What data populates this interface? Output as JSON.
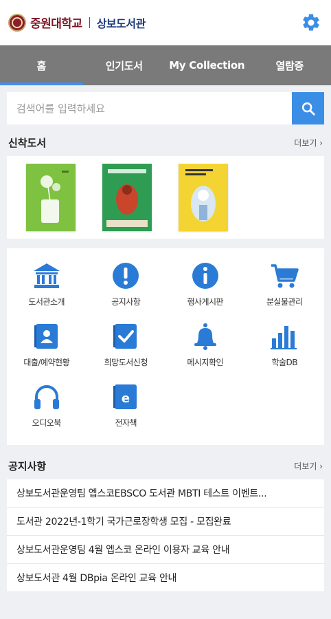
{
  "header": {
    "univ_name": "중원대학교",
    "lib_name": "상보도서관",
    "settings_icon": "gear-icon"
  },
  "tabs": [
    {
      "label": "홈",
      "active": true
    },
    {
      "label": "인기도서",
      "active": false
    },
    {
      "label": "My Collection",
      "active": false
    },
    {
      "label": "열람증",
      "active": false
    }
  ],
  "search": {
    "placeholder": "검색어를 입력하세요",
    "value": ""
  },
  "new_books": {
    "title": "신착도서",
    "more_label": "더보기 ›"
  },
  "menu": [
    {
      "label": "도서관소개",
      "icon": "library-icon"
    },
    {
      "label": "공지사항",
      "icon": "exclamation-icon"
    },
    {
      "label": "행사게시판",
      "icon": "info-icon"
    },
    {
      "label": "분실물관리",
      "icon": "cart-icon"
    },
    {
      "label": "대출/예약현황",
      "icon": "person-book-icon"
    },
    {
      "label": "희망도서신청",
      "icon": "check-book-icon"
    },
    {
      "label": "메시지확인",
      "icon": "bell-icon"
    },
    {
      "label": "학술DB",
      "icon": "bar-chart-icon"
    },
    {
      "label": "오디오북",
      "icon": "headphones-icon"
    },
    {
      "label": "전자책",
      "icon": "ebook-icon"
    }
  ],
  "notices": {
    "title": "공지사항",
    "more_label": "더보기 ›",
    "items": [
      "상보도서관운영팀 엡스코EBSCO 도서관 MBTI 테스트 이벤트...",
      "도서관 2022년-1학기 국가근로장학생 모집 - 모집완료",
      "상보도서관운영팀 4월 엡스코 온라인 이용자 교육 안내",
      "상보도서관 4월 DBpia 온라인 교육 안내"
    ]
  },
  "colors": {
    "accent": "#3b8ee6",
    "tabbar": "#7a7a7a",
    "brand": "#7c1623"
  }
}
